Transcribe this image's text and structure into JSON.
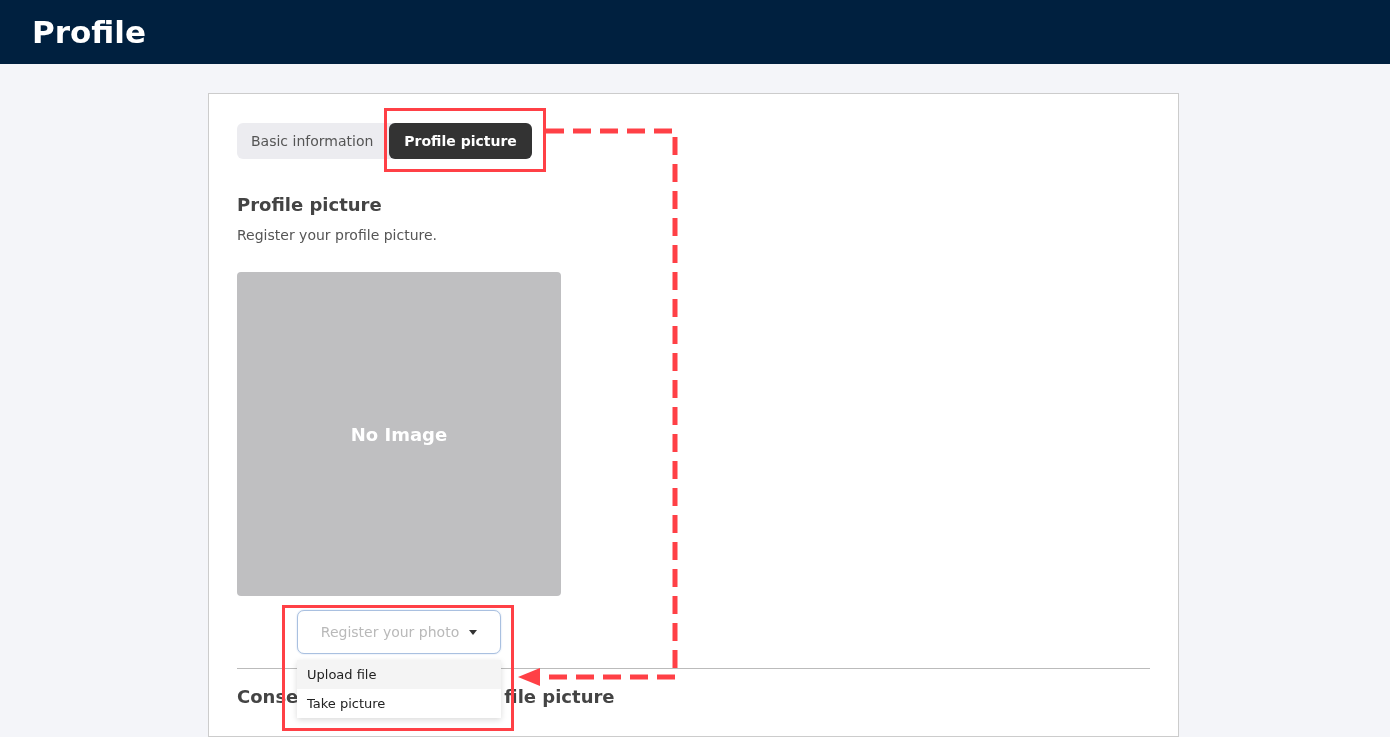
{
  "header": {
    "title": "Profile"
  },
  "tabs": [
    {
      "label": "Basic information",
      "selected": false
    },
    {
      "label": "Profile picture",
      "selected": true
    }
  ],
  "section": {
    "heading": "Profile picture",
    "description": "Register your profile picture.",
    "image_placeholder": "No Image"
  },
  "photo_select": {
    "placeholder": "Register your photo",
    "expanded": true,
    "options": [
      {
        "label": "Upload file",
        "selected": true
      },
      {
        "label": "Take picture",
        "selected": false
      }
    ]
  },
  "next_section": {
    "heading_parts": [
      "Conse",
      "file picture"
    ]
  },
  "annotations": [
    {
      "kind": "highlight-box"
    },
    {
      "kind": "highlight-box"
    },
    {
      "kind": "dashed-arrow"
    }
  ]
}
